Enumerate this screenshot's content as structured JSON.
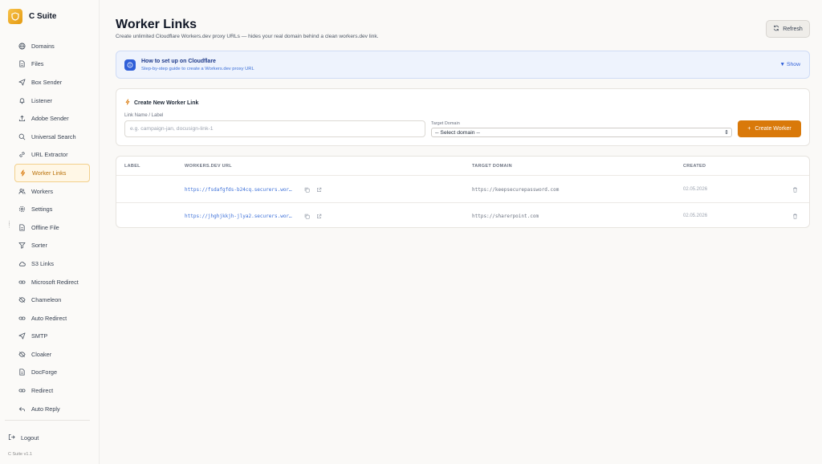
{
  "app": {
    "name": "C Suite",
    "version": "C Suite v1.1"
  },
  "sidebar": {
    "items": [
      {
        "label": "Domains",
        "icon": "globe-icon"
      },
      {
        "label": "Files",
        "icon": "file-icon"
      },
      {
        "label": "Box Sender",
        "icon": "send-icon"
      },
      {
        "label": "Listener",
        "icon": "bell-icon"
      },
      {
        "label": "Adobe Sender",
        "icon": "upload-icon"
      },
      {
        "label": "Universal Search",
        "icon": "search-icon"
      },
      {
        "label": "URL Extractor",
        "icon": "link-icon"
      },
      {
        "label": "Worker Links",
        "icon": "bolt-icon",
        "active": true
      },
      {
        "label": "Workers",
        "icon": "users-icon"
      },
      {
        "label": "Settings",
        "icon": "gear-icon"
      },
      {
        "label": "Offline File",
        "icon": "file-icon"
      },
      {
        "label": "Sorter",
        "icon": "filter-icon"
      },
      {
        "label": "S3 Links",
        "icon": "cloud-icon"
      },
      {
        "label": "Microsoft Redirect",
        "icon": "link-icon"
      },
      {
        "label": "Chameleon",
        "icon": "eye-off-icon"
      },
      {
        "label": "Auto Redirect",
        "icon": "link-icon"
      },
      {
        "label": "SMTP",
        "icon": "send-icon"
      },
      {
        "label": "Cloaker",
        "icon": "eye-off-icon"
      },
      {
        "label": "DocForge",
        "icon": "file-icon"
      },
      {
        "label": "Redirect",
        "icon": "link-icon"
      },
      {
        "label": "Auto Reply",
        "icon": "reply-icon"
      }
    ],
    "logout_label": "Logout"
  },
  "header": {
    "title": "Worker Links",
    "subtitle": "Create unlimited Cloudflare Workers.dev proxy URLs — hides your real domain behind a clean workers.dev link.",
    "refresh_label": "Refresh"
  },
  "setup": {
    "title": "How to set up on Cloudflare",
    "subtitle": "Step-by-step guide to create a Workers.dev proxy URL",
    "toggle_label": "▼ Show"
  },
  "create": {
    "heading": "Create New Worker Link",
    "name_label": "Link Name / Label",
    "name_placeholder": "e.g. campaign-jan, docusign-link-1",
    "name_value": "",
    "domain_label": "Target Domain",
    "domain_selected": "-- Select domain --",
    "button_label": "Create Worker"
  },
  "table": {
    "columns": [
      "LABEL",
      "WORKERS.DEV URL",
      "TARGET DOMAIN",
      "CREATED"
    ],
    "rows": [
      {
        "label": "",
        "url": "https://fsdafgfds-b24cq.securers.wor…",
        "domain": "https://keepsecurepassword.com",
        "created": "02.05.2026"
      },
      {
        "label": "",
        "url": "https://jhghjkkjh-jlya2.securers.wor…",
        "domain": "https://sharerpoint.com",
        "created": "02.05.2026"
      }
    ]
  },
  "colors": {
    "accent": "#d9790a",
    "link": "#3b6fd8",
    "info_bg": "#eef3fd"
  }
}
